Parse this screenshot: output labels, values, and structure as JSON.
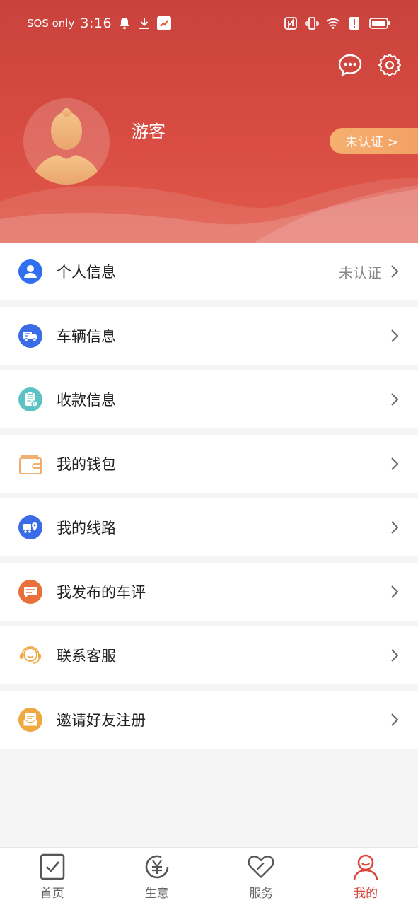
{
  "status_bar": {
    "carrier": "SOS only",
    "time": "3:16"
  },
  "profile": {
    "username": "游客",
    "verify_badge": "未认证 >"
  },
  "menu": [
    {
      "label": "个人信息",
      "value": "未认证",
      "icon": "person-icon",
      "color": "#2f6ff0"
    },
    {
      "label": "车辆信息",
      "value": "",
      "icon": "truck-icon",
      "color": "#3a6ce8"
    },
    {
      "label": "收款信息",
      "value": "",
      "icon": "clipboard-icon",
      "color": "#5cc3c4"
    },
    {
      "label": "我的钱包",
      "value": "",
      "icon": "wallet-icon",
      "color": "#f0a45e"
    },
    {
      "label": "我的线路",
      "value": "",
      "icon": "route-icon",
      "color": "#3a6ce8"
    },
    {
      "label": "我发布的车评",
      "value": "",
      "icon": "comment-icon",
      "color": "#e9703a"
    },
    {
      "label": "联系客服",
      "value": "",
      "icon": "headset-icon",
      "color": "#f0a940"
    },
    {
      "label": "邀请好友注册",
      "value": "",
      "icon": "invite-icon",
      "color": "#f0a940"
    }
  ],
  "bottom_nav": [
    {
      "label": "首页",
      "icon": "home-check-icon",
      "active": false
    },
    {
      "label": "生意",
      "icon": "yuan-icon",
      "active": false
    },
    {
      "label": "服务",
      "icon": "heart-icon",
      "active": false
    },
    {
      "label": "我的",
      "icon": "user-icon",
      "active": true
    }
  ],
  "colors": {
    "header_red": "#d94d42",
    "accent": "#d9453b",
    "badge_orange": "#f2a064"
  }
}
